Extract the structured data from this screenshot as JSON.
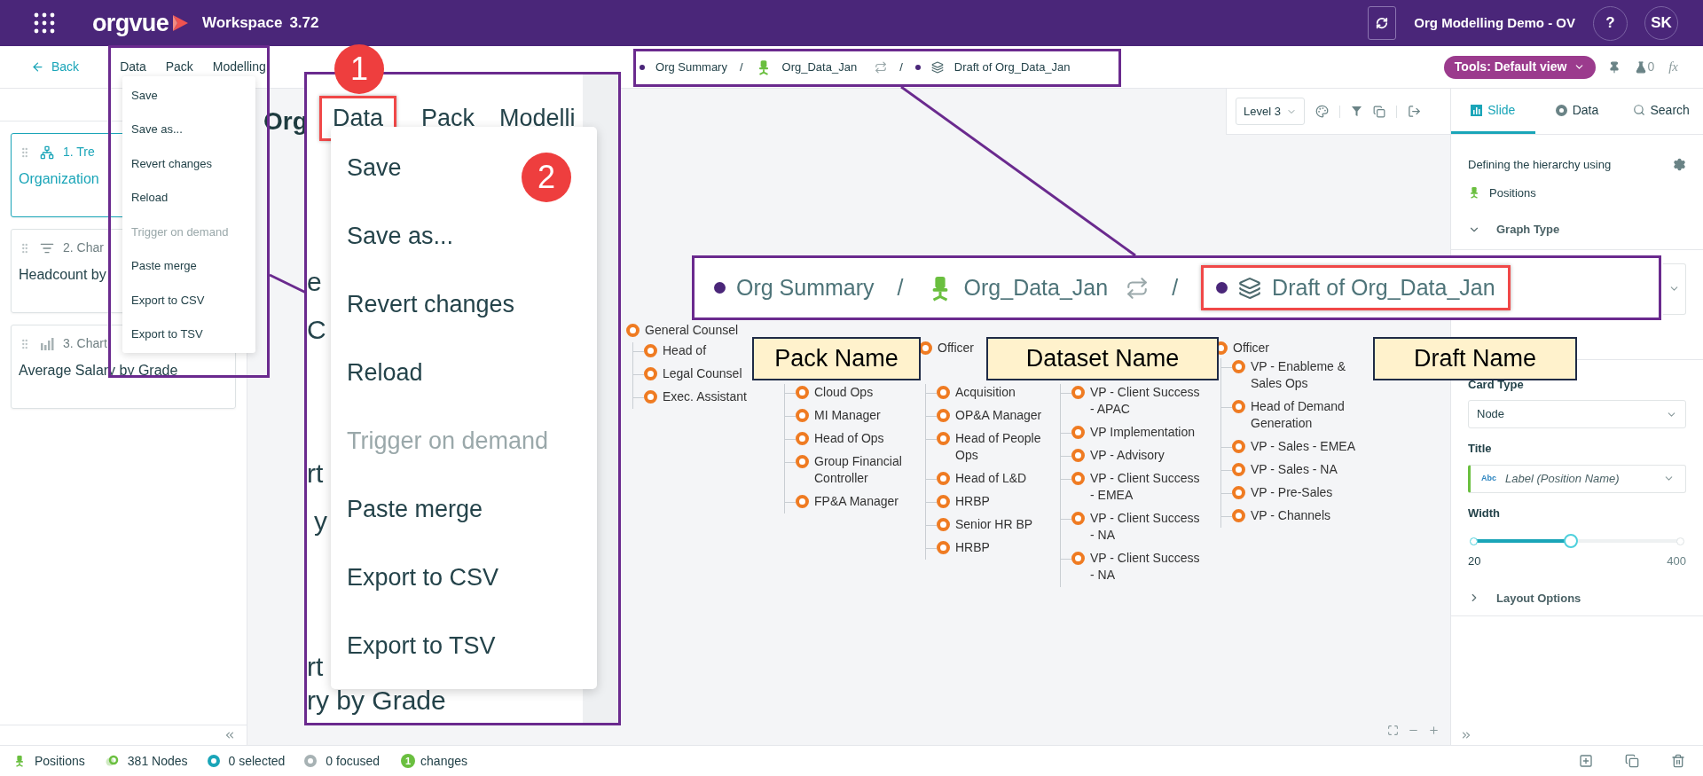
{
  "app": {
    "logo": "orgvue",
    "workspace": "Workspace",
    "version": "3.72",
    "project": "Org Modelling Demo - OV",
    "help": "?",
    "user": "SK"
  },
  "nav": {
    "back": "Back",
    "menus": [
      "Data",
      "Pack",
      "Modelling"
    ]
  },
  "breadcrumb": [
    {
      "kind": "pack",
      "label": "Org Summary"
    },
    {
      "kind": "dataset",
      "separator": "/",
      "label": "Org_Data_Jan"
    },
    {
      "kind": "draft",
      "separator": "/",
      "label": "Draft of Org_Data_Jan"
    }
  ],
  "tools": {
    "view": "Tools: Default view",
    "flask_count": "0",
    "formula": "fx"
  },
  "data_menu": [
    {
      "label": "Save",
      "disabled": false
    },
    {
      "label": "Save as...",
      "disabled": false
    },
    {
      "label": "Revert changes",
      "disabled": false
    },
    {
      "label": "Reload",
      "disabled": false
    },
    {
      "label": "Trigger on demand",
      "disabled": true
    },
    {
      "label": "Paste merge",
      "disabled": false
    },
    {
      "label": "Export to CSV",
      "disabled": false
    },
    {
      "label": "Export to TSV",
      "disabled": false
    }
  ],
  "slides": [
    {
      "kind": "tree",
      "number": "1. Tre",
      "title": "Organization",
      "selected": true
    },
    {
      "kind": "list",
      "number": "2. Char",
      "title": "Headcount by",
      "selected": false
    },
    {
      "kind": "bars",
      "number": "3. Chart",
      "title": "Average Salary by Grade",
      "selected": false
    }
  ],
  "canvas": {
    "title": "Org",
    "level": "Level 3"
  },
  "org_chart": {
    "columns": [
      {
        "header": "General Counsel",
        "nodes": [
          "Head of",
          "Legal Counsel",
          "Exec. Assistant"
        ]
      },
      {
        "nodes": [
          "Cloud Ops",
          "MI Manager",
          "Head of Ops",
          "Group Financial Controller",
          "FP&A Manager"
        ]
      },
      {
        "header": "Officer",
        "nodes": [
          "Acquisition",
          "OP&A Manager",
          "Head of People Ops",
          "Head of L&D",
          "HRBP",
          "Senior HR BP",
          "HRBP"
        ]
      },
      {
        "nodes": [
          "VP - Client Success - APAC",
          "VP Implementation",
          "VP - Advisory",
          "VP - Client Success - EMEA",
          "VP - Client Success - NA",
          "VP - Client Success - NA"
        ]
      },
      {
        "header": "Officer",
        "nodes": [
          "VP - Enableme & Sales Ops",
          "Head of Demand Generation",
          "VP - Sales - EMEA",
          "VP - Sales - NA",
          "VP - Pre-Sales",
          "VP - Channels"
        ]
      }
    ]
  },
  "panel": {
    "tabs": [
      {
        "label": "Slide",
        "selected": true
      },
      {
        "label": "Data",
        "selected": false
      },
      {
        "label": "Search",
        "selected": false
      }
    ],
    "hierarchy_label": "Defining the hierarchy using",
    "hierarchy": "Positions",
    "graph_type": {
      "label": "Graph Type",
      "expanded": true
    },
    "card_type": {
      "label": "Card Type",
      "value": "Node"
    },
    "title": {
      "label": "Title",
      "badge": "Abc",
      "value": "Label (Position Name)"
    },
    "width": {
      "label": "Width",
      "level": 0.47,
      "min": "20",
      "max": "400"
    },
    "layout_options": {
      "label": "Layout Options",
      "expanded": false
    }
  },
  "status": {
    "hierarchy": "Positions",
    "nodes": "381 Nodes",
    "selected": "0 selected",
    "focused": "0 focused",
    "changes_count": "1",
    "changes": "changes"
  },
  "callouts": {
    "menu_zoom": {
      "menus": [
        "Data",
        "Pack",
        "Modelli"
      ],
      "items": [
        {
          "label": "Save",
          "disabled": false
        },
        {
          "label": "Save as...",
          "disabled": false
        },
        {
          "label": "Revert changes",
          "disabled": false
        },
        {
          "label": "Reload",
          "disabled": false
        },
        {
          "label": "Trigger on demand",
          "disabled": true
        },
        {
          "label": "Paste merge",
          "disabled": false
        },
        {
          "label": "Export to CSV",
          "disabled": false
        },
        {
          "label": "Export to TSV",
          "disabled": false
        }
      ],
      "fragments": [
        "e",
        "C",
        "rt",
        "y",
        "rt",
        "ry by Grade"
      ]
    },
    "breadcrumb_zoom": [
      {
        "kind": "pack",
        "label": "Org Summary"
      },
      {
        "kind": "dataset",
        "separator": "/",
        "label": "Org_Data_Jan"
      },
      {
        "kind": "draft",
        "separator": "/",
        "label": "Draft of Org_Data_Jan"
      }
    ],
    "badges": [
      "1",
      "2"
    ],
    "labels": [
      "Pack Name",
      "Dataset Name",
      "Draft Name"
    ]
  }
}
